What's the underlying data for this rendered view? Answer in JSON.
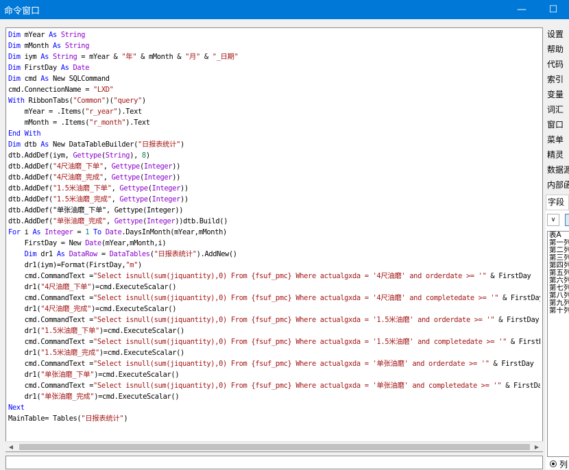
{
  "window": {
    "title": "命令窗口",
    "minimize_glyph": "—",
    "maximize_glyph": "☐"
  },
  "code": [
    [
      [
        "kw",
        "Dim"
      ],
      [
        "t",
        " mYear "
      ],
      [
        "kw",
        "As"
      ],
      [
        "t",
        " "
      ],
      [
        "ty",
        "String"
      ]
    ],
    [
      [
        "kw",
        "Dim"
      ],
      [
        "t",
        " mMonth "
      ],
      [
        "kw",
        "As"
      ],
      [
        "t",
        " "
      ],
      [
        "ty",
        "String"
      ]
    ],
    [
      [
        "kw",
        "Dim"
      ],
      [
        "t",
        " iym "
      ],
      [
        "kw",
        "As"
      ],
      [
        "t",
        " "
      ],
      [
        "ty",
        "String"
      ],
      [
        "t",
        " = mYear & "
      ],
      [
        "str",
        "\"年\""
      ],
      [
        "t",
        " & mMonth & "
      ],
      [
        "str",
        "\"月\""
      ],
      [
        "t",
        " & "
      ],
      [
        "str",
        "\"_日期\""
      ]
    ],
    [
      [
        "kw",
        "Dim"
      ],
      [
        "t",
        " FirstDay "
      ],
      [
        "kw",
        "As"
      ],
      [
        "t",
        " "
      ],
      [
        "ty",
        "Date"
      ]
    ],
    [
      [
        "kw",
        "Dim"
      ],
      [
        "t",
        " cmd "
      ],
      [
        "kw",
        "As"
      ],
      [
        "t",
        " New SQLCommand"
      ]
    ],
    [
      [
        "t",
        "cmd.ConnectionName = "
      ],
      [
        "str",
        "\"LXD\""
      ]
    ],
    [
      [
        "kw",
        "With"
      ],
      [
        "t",
        " RibbonTabs("
      ],
      [
        "str",
        "\"Common\""
      ],
      [
        "t",
        ")("
      ],
      [
        "str",
        "\"query\""
      ],
      [
        "t",
        ")"
      ]
    ],
    [
      [
        "t",
        "    mYear = .Items("
      ],
      [
        "str",
        "\"r_year\""
      ],
      [
        "t",
        ").Text"
      ]
    ],
    [
      [
        "t",
        "    mMonth = .Items("
      ],
      [
        "str",
        "\"r_month\""
      ],
      [
        "t",
        ").Text"
      ]
    ],
    [
      [
        "kw",
        "End With"
      ]
    ],
    [
      [
        "kw",
        "Dim"
      ],
      [
        "t",
        " dtb "
      ],
      [
        "kw",
        "As"
      ],
      [
        "t",
        " New DataTableBuilder("
      ],
      [
        "str",
        "\"日报表统计\""
      ],
      [
        "t",
        ")"
      ]
    ],
    [
      [
        "t",
        "dtb.AddDef(iym, "
      ],
      [
        "ty",
        "Gettype"
      ],
      [
        "t",
        "("
      ],
      [
        "ty",
        "String"
      ],
      [
        "t",
        "), "
      ],
      [
        "num",
        "8"
      ],
      [
        "t",
        ")"
      ]
    ],
    [
      [
        "t",
        "dtb.AddDef("
      ],
      [
        "str",
        "\"4尺油磨_下单\""
      ],
      [
        "t",
        ", "
      ],
      [
        "ty",
        "Gettype"
      ],
      [
        "t",
        "("
      ],
      [
        "ty",
        "Integer"
      ],
      [
        "t",
        "))"
      ]
    ],
    [
      [
        "t",
        "dtb.AddDef("
      ],
      [
        "str",
        "\"4尺油磨_完成\""
      ],
      [
        "t",
        ", "
      ],
      [
        "ty",
        "Gettype"
      ],
      [
        "t",
        "("
      ],
      [
        "ty",
        "Integer"
      ],
      [
        "t",
        "))"
      ]
    ],
    [
      [
        "t",
        "dtb.AddDef("
      ],
      [
        "str",
        "\"1.5米油磨_下单\""
      ],
      [
        "t",
        ", "
      ],
      [
        "ty",
        "Gettype"
      ],
      [
        "t",
        "("
      ],
      [
        "ty",
        "Integer"
      ],
      [
        "t",
        "))"
      ]
    ],
    [
      [
        "t",
        "dtb.AddDef("
      ],
      [
        "str",
        "\"1.5米油磨_完成\""
      ],
      [
        "t",
        ", "
      ],
      [
        "ty",
        "Gettype"
      ],
      [
        "t",
        "("
      ],
      [
        "ty",
        "Integer"
      ],
      [
        "t",
        "))"
      ]
    ],
    [
      [
        "t",
        "dtb.AddDef(\"单张油磨_下单\", Gettype(Integer))"
      ]
    ],
    [
      [
        "t",
        "dtb.AddDef("
      ],
      [
        "str",
        "\"单张油磨_完成\""
      ],
      [
        "t",
        ", "
      ],
      [
        "ty",
        "Gettype"
      ],
      [
        "t",
        "("
      ],
      [
        "ty",
        "Integer"
      ],
      [
        "t",
        "))dtb.Build()"
      ]
    ],
    [
      [
        "kw",
        "For"
      ],
      [
        "t",
        " i "
      ],
      [
        "kw",
        "As"
      ],
      [
        "t",
        " "
      ],
      [
        "ty",
        "Integer"
      ],
      [
        "t",
        " = "
      ],
      [
        "num",
        "1"
      ],
      [
        "t",
        " "
      ],
      [
        "kw",
        "To"
      ],
      [
        "t",
        " "
      ],
      [
        "ty",
        "Date"
      ],
      [
        "t",
        ".DaysInMonth(mYear,mMonth)"
      ]
    ],
    [
      [
        "t",
        "    FirstDay = New "
      ],
      [
        "ty",
        "Date"
      ],
      [
        "t",
        "(mYear,mMonth,i)"
      ]
    ],
    [
      [
        "t",
        "    "
      ],
      [
        "kw",
        "Dim"
      ],
      [
        "t",
        " dr1 "
      ],
      [
        "kw",
        "As"
      ],
      [
        "t",
        " "
      ],
      [
        "ty",
        "DataRow"
      ],
      [
        "t",
        " = "
      ],
      [
        "ty",
        "DataTables"
      ],
      [
        "t",
        "("
      ],
      [
        "str",
        "\"日报表统计\""
      ],
      [
        "t",
        ").AddNew()"
      ]
    ],
    [
      [
        "t",
        "    dr1(iym)=Format(FirstDay,"
      ],
      [
        "str",
        "\"m\""
      ],
      [
        "t",
        ")"
      ]
    ],
    [
      [
        "t",
        "    cmd.CommandText ="
      ],
      [
        "str",
        "\"Select isnull(sum(jiquantity),0) From {fsuf_pmc} Where actualgxda = '4尺油磨' and orderdate >= '\""
      ],
      [
        "t",
        " & FirstDay"
      ]
    ],
    [
      [
        "t",
        "    dr1("
      ],
      [
        "str",
        "\"4尺油磨_下单\""
      ],
      [
        "t",
        ")=cmd.ExecuteScalar()"
      ]
    ],
    [
      [
        "t",
        "    cmd.CommandText ="
      ],
      [
        "str",
        "\"Select isnull(sum(jiquantity),0) From {fsuf_pmc} Where actualgxda = '4尺油磨' and completedate >= '\""
      ],
      [
        "t",
        " & FirstDay"
      ]
    ],
    [
      [
        "t",
        "    dr1("
      ],
      [
        "str",
        "\"4尺油磨_完成\""
      ],
      [
        "t",
        ")=cmd.ExecuteScalar()"
      ]
    ],
    [
      [
        "t",
        "    cmd.CommandText ="
      ],
      [
        "str",
        "\"Select isnull(sum(jiquantity),0) From {fsuf_pmc} Where actualgxda = '1.5米油磨' and orderdate >= '\""
      ],
      [
        "t",
        " & FirstDay"
      ]
    ],
    [
      [
        "t",
        "    dr1("
      ],
      [
        "str",
        "\"1.5米油磨_下单\""
      ],
      [
        "t",
        ")=cmd.ExecuteScalar()"
      ]
    ],
    [
      [
        "t",
        "    cmd.CommandText ="
      ],
      [
        "str",
        "\"Select isnull(sum(jiquantity),0) From {fsuf_pmc} Where actualgxda = '1.5米油磨' and completedate >= '\""
      ],
      [
        "t",
        " & FirstDay"
      ]
    ],
    [
      [
        "t",
        "    dr1("
      ],
      [
        "str",
        "\"1.5米油磨_完成\""
      ],
      [
        "t",
        ")=cmd.ExecuteScalar()"
      ]
    ],
    [
      [
        "t",
        "    cmd.CommandText ="
      ],
      [
        "str",
        "\"Select isnull(sum(jiquantity),0) From {fsuf_pmc} Where actualgxda = '单张油磨' and orderdate >= '\""
      ],
      [
        "t",
        " & FirstDay"
      ]
    ],
    [
      [
        "t",
        "    dr1("
      ],
      [
        "str",
        "\"单张油磨_下单\""
      ],
      [
        "t",
        ")=cmd.ExecuteScalar()"
      ]
    ],
    [
      [
        "t",
        "    cmd.CommandText ="
      ],
      [
        "str",
        "\"Select isnull(sum(jiquantity),0) From {fsuf_pmc} Where actualgxda = '单张油磨' and completedate >= '\""
      ],
      [
        "t",
        " & FirstDay"
      ]
    ],
    [
      [
        "t",
        "    dr1("
      ],
      [
        "str",
        "\"单张油磨_完成\""
      ],
      [
        "t",
        ")=cmd.ExecuteScalar()"
      ]
    ],
    [
      [
        "kw",
        "Next"
      ]
    ],
    [
      [
        "t",
        "MainTable= Tables("
      ],
      [
        "str",
        "\"日报表统计\""
      ],
      [
        "t",
        ")"
      ]
    ]
  ],
  "sidebar": {
    "buttons": [
      "设置",
      "帮助",
      "代码",
      "索引",
      "变量",
      "词汇",
      "窗口",
      "菜单",
      "精灵",
      "数据源",
      "内部函数"
    ],
    "tab_label": "字段",
    "select_glyph": "∨",
    "field_items": [
      "表A",
      "第一列",
      "第二列",
      "第三列",
      "第四列",
      "第五列",
      "第六列",
      "第七列",
      "第八列",
      "第九列",
      "第十列"
    ],
    "radio_label": "列"
  },
  "scrollbar": {
    "left_arrow": "◀",
    "right_arrow": "▶"
  },
  "colors": {
    "title_bar": "#0078d7",
    "keyword": "#0000ff",
    "string": "#a31515",
    "type": "#8b00cc"
  }
}
